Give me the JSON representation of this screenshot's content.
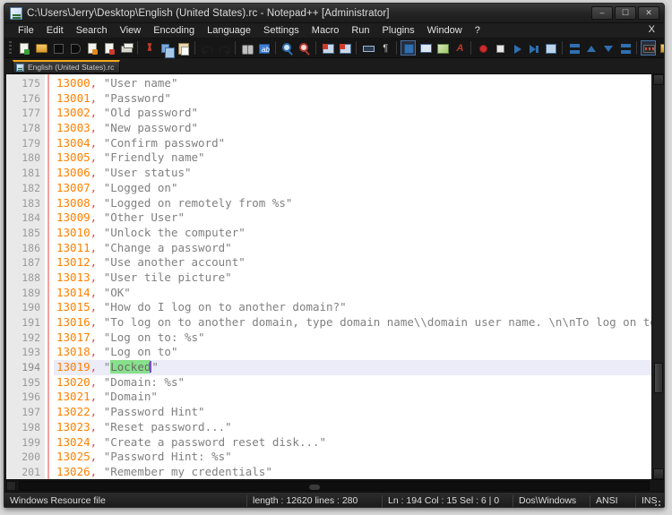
{
  "window": {
    "title": "C:\\Users\\Jerry\\Desktop\\English (United States).rc - Notepad++ [Administrator]",
    "minimize_label": "–",
    "maximize_label": "☐",
    "close_label": "✕"
  },
  "menu": {
    "items": [
      {
        "label": "File"
      },
      {
        "label": "Edit"
      },
      {
        "label": "Search"
      },
      {
        "label": "View"
      },
      {
        "label": "Encoding"
      },
      {
        "label": "Language"
      },
      {
        "label": "Settings"
      },
      {
        "label": "Macro"
      },
      {
        "label": "Run"
      },
      {
        "label": "Plugins"
      },
      {
        "label": "Window"
      },
      {
        "label": "?"
      }
    ],
    "close_document_label": "X"
  },
  "toolbar": {
    "icons": [
      "new-file-icon",
      "open-file-icon",
      "save-file-icon",
      "save-all-icon",
      "close-file-icon",
      "close-all-icon",
      "print-icon",
      "cut-icon",
      "copy-icon",
      "paste-icon",
      "undo-icon",
      "redo-icon",
      "find-icon",
      "replace-icon",
      "zoom-in-icon",
      "zoom-out-icon",
      "sync-vertical-icon",
      "sync-horizontal-icon",
      "word-wrap-icon",
      "show-all-chars-icon",
      "indent-guide-icon",
      "user-defined-dialog-icon",
      "document-map-icon",
      "function-list-icon",
      "record-macro-icon",
      "stop-recording-icon",
      "play-macro-icon",
      "play-multiple-icon",
      "save-macro-icon",
      "collapse-all-icon",
      "expand-one-level-icon",
      "collapse-one-level-icon",
      "expand-all-icon",
      "syntax-highlight-icon",
      "folder-as-workspace-icon",
      "spell-check-icon"
    ]
  },
  "tabs": [
    {
      "label": "English (United States).rc",
      "icon": "file-icon",
      "active": true
    }
  ],
  "editor": {
    "lines": [
      {
        "number": "175",
        "id": "13000",
        "text": "\"User name\"",
        "active": false
      },
      {
        "number": "176",
        "id": "13001",
        "text": "\"Password\"",
        "active": false
      },
      {
        "number": "177",
        "id": "13002",
        "text": "\"Old password\"",
        "active": false
      },
      {
        "number": "178",
        "id": "13003",
        "text": "\"New password\"",
        "active": false
      },
      {
        "number": "179",
        "id": "13004",
        "text": "\"Confirm password\"",
        "active": false
      },
      {
        "number": "180",
        "id": "13005",
        "text": "\"Friendly name\"",
        "active": false
      },
      {
        "number": "181",
        "id": "13006",
        "text": "\"User status\"",
        "active": false
      },
      {
        "number": "182",
        "id": "13007",
        "text": "\"Logged on\"",
        "active": false
      },
      {
        "number": "183",
        "id": "13008",
        "text": "\"Logged on remotely from %s\"",
        "active": false
      },
      {
        "number": "184",
        "id": "13009",
        "text": "\"Other User\"",
        "active": false
      },
      {
        "number": "185",
        "id": "13010",
        "text": "\"Unlock the computer\"",
        "active": false
      },
      {
        "number": "186",
        "id": "13011",
        "text": "\"Change a password\"",
        "active": false
      },
      {
        "number": "187",
        "id": "13012",
        "text": "\"Use another account\"",
        "active": false
      },
      {
        "number": "188",
        "id": "13013",
        "text": "\"User tile picture\"",
        "active": false
      },
      {
        "number": "189",
        "id": "13014",
        "text": "\"OK\"",
        "active": false
      },
      {
        "number": "190",
        "id": "13015",
        "text": "\"How do I log on to another domain?\"",
        "active": false
      },
      {
        "number": "191",
        "id": "13016",
        "text": "\"To log on to another domain, type domain name\\\\domain user name. \\n\\nTo log on to",
        "active": false
      },
      {
        "number": "192",
        "id": "13017",
        "text": "\"Log on to: %s\"",
        "active": false
      },
      {
        "number": "193",
        "id": "13018",
        "text": "\"Log on to\"",
        "active": false
      },
      {
        "number": "194",
        "id": "13019",
        "text": "\"Locked\"",
        "active": true,
        "selection": "Locked",
        "prefix": "\"",
        "suffix": "\""
      },
      {
        "number": "195",
        "id": "13020",
        "text": "\"Domain: %s\"",
        "active": false
      },
      {
        "number": "196",
        "id": "13021",
        "text": "\"Domain\"",
        "active": false
      },
      {
        "number": "197",
        "id": "13022",
        "text": "\"Password Hint\"",
        "active": false
      },
      {
        "number": "198",
        "id": "13023",
        "text": "\"Reset password...\"",
        "active": false
      },
      {
        "number": "199",
        "id": "13024",
        "text": "\"Create a password reset disk...\"",
        "active": false
      },
      {
        "number": "200",
        "id": "13025",
        "text": "\"Password Hint: %s\"",
        "active": false
      },
      {
        "number": "201",
        "id": "13026",
        "text": "\"Remember my credentials\"",
        "active": false
      }
    ],
    "separator": ",",
    "colors": {
      "number": "#ff8000",
      "comma": "#e04c4c",
      "string": "#808080",
      "selection": "#87e08a",
      "active_line": "#ececf8",
      "caret": "#7a4fd0",
      "tab_accent": "#f0a818"
    }
  },
  "statusbar": {
    "language": "Windows Resource file",
    "length_lines": "length : 12620   lines : 280",
    "position": "Ln : 194     Col : 15     Sel : 6 | 0",
    "eol": "Dos\\Windows",
    "encoding": "ANSI",
    "insert_mode": "INS"
  }
}
